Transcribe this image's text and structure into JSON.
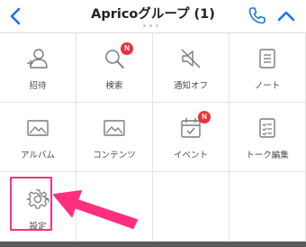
{
  "header": {
    "title": "Apricoグループ (1)",
    "back_icon": "chevron-left-icon",
    "call_icon": "phone-icon",
    "collapse_icon": "chevron-up-icon",
    "accent_color": "#1a73e8"
  },
  "menu": {
    "items": [
      {
        "label": "招待",
        "icon": "add-user-icon"
      },
      {
        "label": "検索",
        "icon": "search-icon",
        "badge": "N"
      },
      {
        "label": "通知オフ",
        "icon": "mute-icon"
      },
      {
        "label": "ノート",
        "icon": "note-icon"
      },
      {
        "label": "アルバム",
        "icon": "album-icon"
      },
      {
        "label": "コンテンツ",
        "icon": "contents-icon"
      },
      {
        "label": "イベント",
        "icon": "calendar-icon",
        "badge": "N"
      },
      {
        "label": "トーク編集",
        "icon": "edit-list-icon"
      },
      {
        "label": "設定",
        "icon": "gear-icon"
      }
    ]
  },
  "annotation": {
    "highlight_color": "#ff2f7e"
  }
}
